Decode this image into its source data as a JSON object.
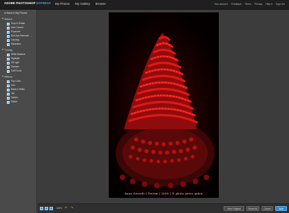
{
  "header": {
    "brand": "ADOBE PHOTOSHOP",
    "brand_suffix": "EXPRESS",
    "nav": [
      "My Photos",
      "My Gallery",
      "Browse"
    ],
    "links": [
      "Your account",
      "Feedback",
      "Terms",
      "Privacy",
      "Help ▾",
      "Sign Out"
    ]
  },
  "sidebar": {
    "back_label": "Back to My Photos",
    "sections": [
      {
        "title": "Basics",
        "items": [
          "Crop & Rotate",
          "Auto Correct",
          "Exposure",
          "Red-Eye Removal",
          "Touchup",
          "Saturation"
        ]
      },
      {
        "title": "Tuning",
        "items": [
          "White Balance",
          "Highlight",
          "Fill Light",
          "Sharpen",
          "Soft Focus"
        ]
      },
      {
        "title": "Effects",
        "items": [
          "Pop Color",
          "Hue",
          "Black & White",
          "Tint",
          "Sketch",
          "Distort"
        ]
      }
    ]
  },
  "photo": {
    "caption": "Anna Gerardi | Teitem | 2008 | © photo peter gabin",
    "colors": {
      "background": "#050000",
      "red": "#d01313",
      "highlight": "#ff5a4a"
    }
  },
  "bottombar": {
    "zoom": "119%",
    "undo_icon": "undo-icon",
    "redo_icon": "redo-icon",
    "buttons": {
      "view_original": "View Original",
      "reset_all": "Reset All",
      "cancel": "Cancel",
      "save": "Save"
    }
  }
}
